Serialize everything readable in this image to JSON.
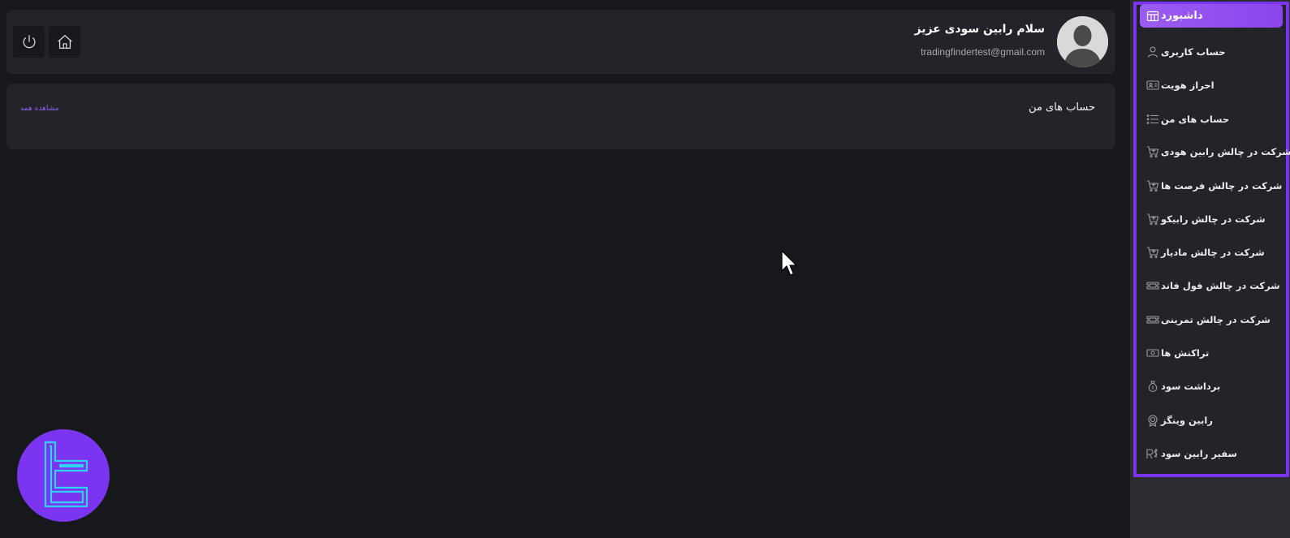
{
  "user": {
    "greeting": "سلام رابین سودی عزیز",
    "email": "tradingfindertest@gmail.com"
  },
  "accounts": {
    "title": "حساب های من",
    "view_all": "مشاهده همه"
  },
  "sidebar": {
    "items": [
      {
        "label": "داشبورد",
        "icon": "table-icon",
        "active": true
      },
      {
        "label": "حساب کاربری",
        "icon": "user-icon"
      },
      {
        "label": "احراز هویت",
        "icon": "id-card-icon"
      },
      {
        "label": "حساب های من",
        "icon": "list-icon"
      },
      {
        "label": "شرکت در چالش رابین هودی",
        "icon": "cart-plus-icon"
      },
      {
        "label": "شرکت در چالش فرصت ها",
        "icon": "cart-plus-icon"
      },
      {
        "label": "شرکت در چالش رابیکو",
        "icon": "cart-plus-icon"
      },
      {
        "label": "شرکت در چالش مادیار",
        "icon": "cart-plus-icon"
      },
      {
        "label": "شرکت در چالش فول فاند",
        "icon": "ticket-icon"
      },
      {
        "label": "شرکت در چالش تمرینی",
        "icon": "ticket-icon"
      },
      {
        "label": "تراکنش ها",
        "icon": "cash-icon"
      },
      {
        "label": "برداشت سود",
        "icon": "money-bag-icon"
      },
      {
        "label": "رابین وینگز",
        "icon": "badge-icon"
      },
      {
        "label": "سفیر رابین سود",
        "icon": "ambassador-icon"
      }
    ]
  },
  "colors": {
    "accent": "#7b35f0",
    "active_item": "#9b5cf0",
    "background": "#16181c",
    "card": "#22242a",
    "link": "#8f5ef0",
    "logo_line": "#2fd3f5"
  }
}
